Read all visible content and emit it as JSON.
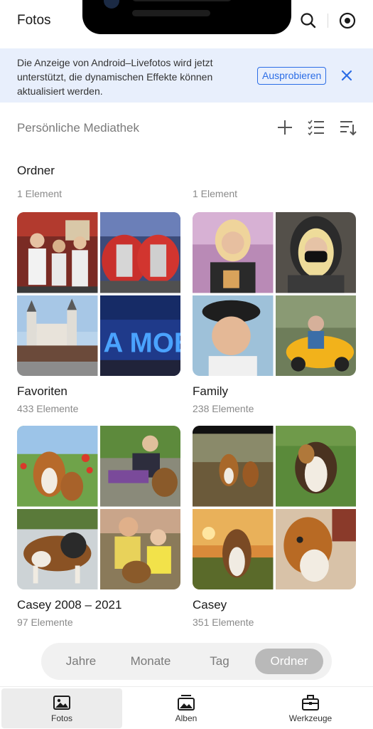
{
  "header": {
    "title": "Fotos",
    "search_icon": "search-icon",
    "more_icon": "target-icon"
  },
  "banner": {
    "text": "Die Anzeige von Android–Livefotos wird jetzt unterstützt, die dynamischen Effekte können aktualisiert werden.",
    "action_label": "Ausprobieren",
    "close_icon": "close-icon",
    "background": "#e8effc",
    "accent": "#2b6de6"
  },
  "library": {
    "title": "Persönliche Mediathek",
    "tools": [
      "plus-icon",
      "checklist-icon",
      "sort-icon"
    ]
  },
  "folders": {
    "title": "Ordner",
    "top_counts": [
      "1 Element",
      "1 Element"
    ],
    "albums": [
      {
        "name": "Favoriten",
        "count": "433 Elemente"
      },
      {
        "name": "Family",
        "count": "238 Elemente"
      },
      {
        "name": "Casey 2008 – 2021",
        "count": "97 Elemente"
      },
      {
        "name": "Casey",
        "count": "351 Elemente"
      }
    ]
  },
  "view_switch": {
    "items": [
      "Jahre",
      "Monate",
      "Tag",
      "Ordner"
    ],
    "active": "Ordner"
  },
  "bottom_nav": {
    "items": [
      {
        "label": "Fotos",
        "icon": "photo-icon",
        "active": true
      },
      {
        "label": "Alben",
        "icon": "albums-icon",
        "active": false
      },
      {
        "label": "Werkzeuge",
        "icon": "toolbox-icon",
        "active": false
      }
    ]
  }
}
